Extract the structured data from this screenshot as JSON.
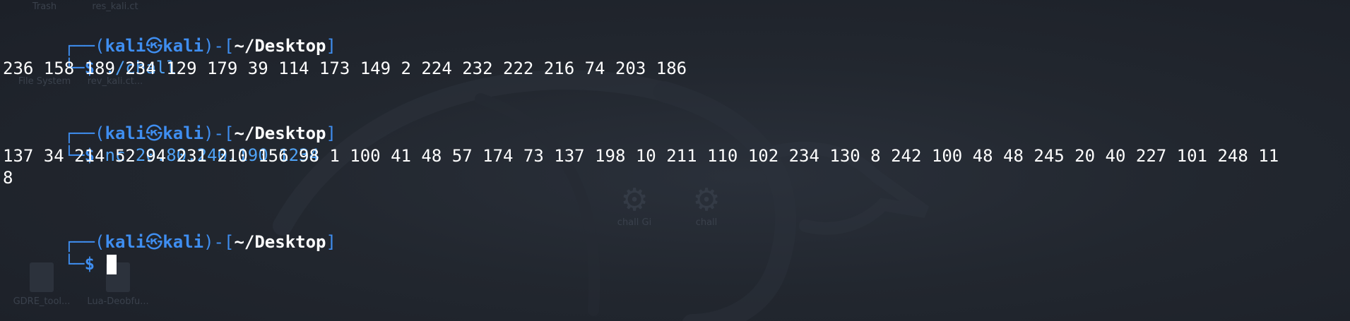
{
  "desktop": {
    "icons": [
      {
        "label": "Trash",
        "kind": "trash-icon"
      },
      {
        "label": "res_kali.ct",
        "kind": "file-icon"
      },
      {
        "label": "File System",
        "kind": "drive-icon"
      },
      {
        "label": "rev_kali.ct...",
        "kind": "file-icon"
      },
      {
        "label": "chall Gi",
        "kind": "gear-icon"
      },
      {
        "label": "chall",
        "kind": "gear-icon"
      },
      {
        "label": "GDRE_tool...",
        "kind": "file-icon"
      },
      {
        "label": "Lua-Deobfu...",
        "kind": "file-icon"
      }
    ]
  },
  "terminal": {
    "prompt": {
      "corner_top": "┌──(",
      "user": "kali",
      "at_symbol": "㉿",
      "host": "kali",
      "mid": ")-[",
      "path": "~/Desktop",
      "close": "]",
      "corner_bottom": "└─",
      "dollar": "$"
    },
    "blocks": [
      {
        "command": "./chall",
        "output": [
          "236 158 189 234 129 179 39 114 173 149 2 224 232 222 216 74 203 186"
        ]
      },
      {
        "command": "nc 20.80.240.190 1234",
        "output": [
          "137 34 214 52 94 231 210 156 98 1 100 41 48 57 174 73 137 198 10 211 110 102 234 130 8 242 100 48 48 245 20 40 227 101 248 11",
          "8"
        ]
      }
    ]
  },
  "colors": {
    "background": "#1f242d",
    "prompt_blue": "#3f8ef0",
    "command_blue": "#4fa3f7",
    "text": "#ffffff"
  }
}
